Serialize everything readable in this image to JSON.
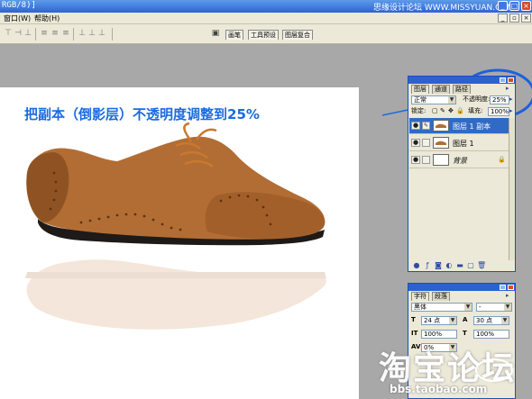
{
  "window": {
    "title": "RGB/8)]",
    "watermark": "思缘设计论坛 WWW.MISSYUAN.COM"
  },
  "menu": {
    "items": [
      "窗口(W)",
      "帮助(H)"
    ]
  },
  "toolbar": {
    "well_tabs": [
      "画笔",
      "工具预设",
      "图层复合"
    ]
  },
  "annotation": {
    "text": "把副本（倒影层）不透明度调整到25%"
  },
  "layers_panel": {
    "tabs": [
      "图层",
      "通道",
      "路径"
    ],
    "blend_mode": "正常",
    "opacity_label": "不透明度:",
    "opacity_value": "25%",
    "lock_label": "锁定:",
    "fill_label": "填充:",
    "fill_value": "100%",
    "layers": [
      {
        "name": "图层 1 副本",
        "selected": true
      },
      {
        "name": "图层 1",
        "selected": false
      },
      {
        "name": "背景",
        "selected": false,
        "locked": true
      }
    ]
  },
  "character_panel": {
    "tabs": [
      "字符",
      "段落"
    ],
    "font_family": "黑体",
    "font_style": "-",
    "font_size": "24 点",
    "leading": "30 点",
    "vertical_scale": "100%",
    "horizontal_scale": "100%",
    "tracking": "0%"
  },
  "footer_watermark": {
    "logo_text": "淘宝论坛",
    "url": "bbs.taobao.com"
  },
  "colors": {
    "annotation": "#1a6be0",
    "highlight_circle": "#1f5fe0",
    "selected_layer": "#316ac5"
  }
}
